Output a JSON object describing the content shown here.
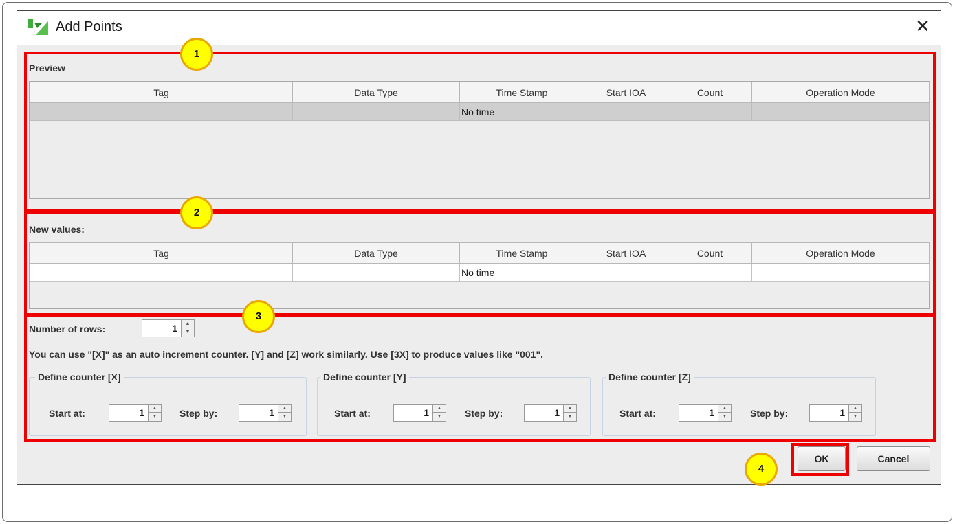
{
  "window": {
    "title": "Add Points"
  },
  "preview": {
    "label": "Preview",
    "columns": [
      "Tag",
      "Data Type",
      "Time Stamp",
      "Start IOA",
      "Count",
      "Operation Mode"
    ],
    "row": [
      "",
      "",
      "No time",
      "",
      "",
      ""
    ]
  },
  "new_values": {
    "label": "New values:",
    "columns": [
      "Tag",
      "Data Type",
      "Time Stamp",
      "Start IOA",
      "Count",
      "Operation Mode"
    ],
    "row": [
      "",
      "",
      "No time",
      "",
      "",
      ""
    ]
  },
  "settings": {
    "rows_label": "Number of rows:",
    "rows_value": "1",
    "hint": "You can use \"[X]\" as an auto increment counter. [Y] and [Z] work similarly. Use [3X] to produce values like \"001\".",
    "counters": [
      {
        "legend": "Define counter [X]",
        "start_label": "Start at:",
        "start_value": "1",
        "step_label": "Step by:",
        "step_value": "1"
      },
      {
        "legend": "Define counter [Y]",
        "start_label": "Start at:",
        "start_value": "1",
        "step_label": "Step by:",
        "step_value": "1"
      },
      {
        "legend": "Define counter [Z]",
        "start_label": "Start at:",
        "start_value": "1",
        "step_label": "Step by:",
        "step_value": "1"
      }
    ]
  },
  "buttons": {
    "ok": "OK",
    "cancel": "Cancel"
  },
  "callouts": [
    "1",
    "2",
    "3",
    "4"
  ],
  "colors": {
    "highlight": "#ee0000",
    "callout_fill": "#ffff00",
    "icon_green": "#3fae3a"
  },
  "icons": {
    "app": "app-logo-icon",
    "close": "close-icon",
    "up": "spinner-up-icon",
    "down": "spinner-down-icon"
  }
}
